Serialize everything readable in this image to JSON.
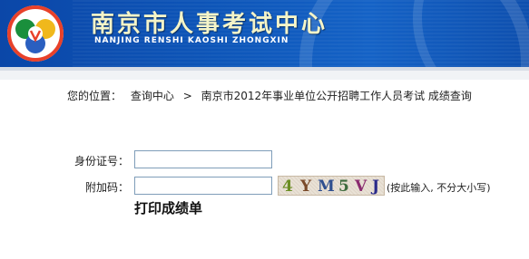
{
  "header": {
    "title": "南京市人事考试中心",
    "subtitle": "NANJING RENSHI KAOSHI ZHONGXIN",
    "logo_colors": [
      "#e8412a",
      "#1a8f3c",
      "#f0b81c",
      "#2a5fc0"
    ]
  },
  "breadcrumb": {
    "prefix": "您的位置：",
    "items": [
      "查询中心",
      "南京市2012年事业单位公开招聘工作人员考试 成绩查询"
    ],
    "separator": ">"
  },
  "form": {
    "id_label": "身份证号：",
    "id_value": "",
    "code_label": "附加码：",
    "code_value": "",
    "captcha": {
      "chars": [
        "4",
        "Y",
        "M",
        "5",
        "V",
        "J"
      ],
      "colors": [
        "#6b8e23",
        "#7a4a2a",
        "#2f4f8f",
        "#3d6b3d",
        "#8a2b6f",
        "#2a2a8a"
      ]
    },
    "hint": "(按此输入, 不分大小写)",
    "submit_label": "打印成绩单"
  }
}
